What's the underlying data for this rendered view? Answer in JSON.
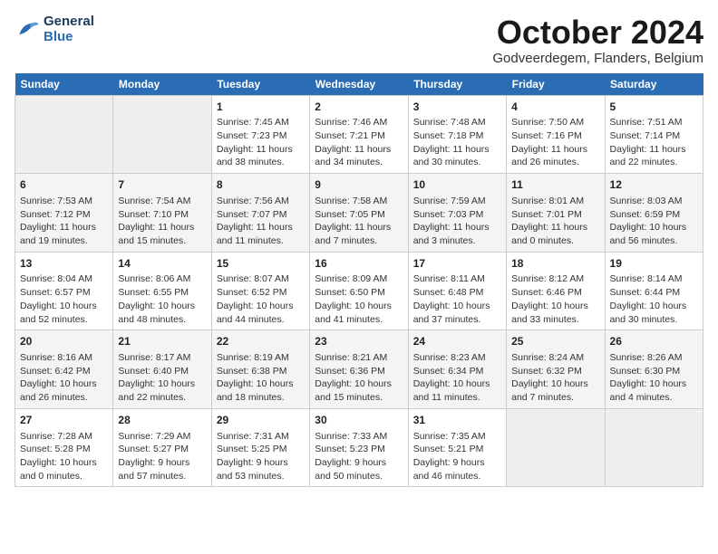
{
  "header": {
    "logo_line1": "General",
    "logo_line2": "Blue",
    "month": "October 2024",
    "location": "Godveerdegem, Flanders, Belgium"
  },
  "weekdays": [
    "Sunday",
    "Monday",
    "Tuesday",
    "Wednesday",
    "Thursday",
    "Friday",
    "Saturday"
  ],
  "weeks": [
    [
      {
        "day": "",
        "empty": true
      },
      {
        "day": "",
        "empty": true
      },
      {
        "day": "1",
        "sunrise": "Sunrise: 7:45 AM",
        "sunset": "Sunset: 7:23 PM",
        "daylight": "Daylight: 11 hours and 38 minutes."
      },
      {
        "day": "2",
        "sunrise": "Sunrise: 7:46 AM",
        "sunset": "Sunset: 7:21 PM",
        "daylight": "Daylight: 11 hours and 34 minutes."
      },
      {
        "day": "3",
        "sunrise": "Sunrise: 7:48 AM",
        "sunset": "Sunset: 7:18 PM",
        "daylight": "Daylight: 11 hours and 30 minutes."
      },
      {
        "day": "4",
        "sunrise": "Sunrise: 7:50 AM",
        "sunset": "Sunset: 7:16 PM",
        "daylight": "Daylight: 11 hours and 26 minutes."
      },
      {
        "day": "5",
        "sunrise": "Sunrise: 7:51 AM",
        "sunset": "Sunset: 7:14 PM",
        "daylight": "Daylight: 11 hours and 22 minutes."
      }
    ],
    [
      {
        "day": "6",
        "sunrise": "Sunrise: 7:53 AM",
        "sunset": "Sunset: 7:12 PM",
        "daylight": "Daylight: 11 hours and 19 minutes."
      },
      {
        "day": "7",
        "sunrise": "Sunrise: 7:54 AM",
        "sunset": "Sunset: 7:10 PM",
        "daylight": "Daylight: 11 hours and 15 minutes."
      },
      {
        "day": "8",
        "sunrise": "Sunrise: 7:56 AM",
        "sunset": "Sunset: 7:07 PM",
        "daylight": "Daylight: 11 hours and 11 minutes."
      },
      {
        "day": "9",
        "sunrise": "Sunrise: 7:58 AM",
        "sunset": "Sunset: 7:05 PM",
        "daylight": "Daylight: 11 hours and 7 minutes."
      },
      {
        "day": "10",
        "sunrise": "Sunrise: 7:59 AM",
        "sunset": "Sunset: 7:03 PM",
        "daylight": "Daylight: 11 hours and 3 minutes."
      },
      {
        "day": "11",
        "sunrise": "Sunrise: 8:01 AM",
        "sunset": "Sunset: 7:01 PM",
        "daylight": "Daylight: 11 hours and 0 minutes."
      },
      {
        "day": "12",
        "sunrise": "Sunrise: 8:03 AM",
        "sunset": "Sunset: 6:59 PM",
        "daylight": "Daylight: 10 hours and 56 minutes."
      }
    ],
    [
      {
        "day": "13",
        "sunrise": "Sunrise: 8:04 AM",
        "sunset": "Sunset: 6:57 PM",
        "daylight": "Daylight: 10 hours and 52 minutes."
      },
      {
        "day": "14",
        "sunrise": "Sunrise: 8:06 AM",
        "sunset": "Sunset: 6:55 PM",
        "daylight": "Daylight: 10 hours and 48 minutes."
      },
      {
        "day": "15",
        "sunrise": "Sunrise: 8:07 AM",
        "sunset": "Sunset: 6:52 PM",
        "daylight": "Daylight: 10 hours and 44 minutes."
      },
      {
        "day": "16",
        "sunrise": "Sunrise: 8:09 AM",
        "sunset": "Sunset: 6:50 PM",
        "daylight": "Daylight: 10 hours and 41 minutes."
      },
      {
        "day": "17",
        "sunrise": "Sunrise: 8:11 AM",
        "sunset": "Sunset: 6:48 PM",
        "daylight": "Daylight: 10 hours and 37 minutes."
      },
      {
        "day": "18",
        "sunrise": "Sunrise: 8:12 AM",
        "sunset": "Sunset: 6:46 PM",
        "daylight": "Daylight: 10 hours and 33 minutes."
      },
      {
        "day": "19",
        "sunrise": "Sunrise: 8:14 AM",
        "sunset": "Sunset: 6:44 PM",
        "daylight": "Daylight: 10 hours and 30 minutes."
      }
    ],
    [
      {
        "day": "20",
        "sunrise": "Sunrise: 8:16 AM",
        "sunset": "Sunset: 6:42 PM",
        "daylight": "Daylight: 10 hours and 26 minutes."
      },
      {
        "day": "21",
        "sunrise": "Sunrise: 8:17 AM",
        "sunset": "Sunset: 6:40 PM",
        "daylight": "Daylight: 10 hours and 22 minutes."
      },
      {
        "day": "22",
        "sunrise": "Sunrise: 8:19 AM",
        "sunset": "Sunset: 6:38 PM",
        "daylight": "Daylight: 10 hours and 18 minutes."
      },
      {
        "day": "23",
        "sunrise": "Sunrise: 8:21 AM",
        "sunset": "Sunset: 6:36 PM",
        "daylight": "Daylight: 10 hours and 15 minutes."
      },
      {
        "day": "24",
        "sunrise": "Sunrise: 8:23 AM",
        "sunset": "Sunset: 6:34 PM",
        "daylight": "Daylight: 10 hours and 11 minutes."
      },
      {
        "day": "25",
        "sunrise": "Sunrise: 8:24 AM",
        "sunset": "Sunset: 6:32 PM",
        "daylight": "Daylight: 10 hours and 7 minutes."
      },
      {
        "day": "26",
        "sunrise": "Sunrise: 8:26 AM",
        "sunset": "Sunset: 6:30 PM",
        "daylight": "Daylight: 10 hours and 4 minutes."
      }
    ],
    [
      {
        "day": "27",
        "sunrise": "Sunrise: 7:28 AM",
        "sunset": "Sunset: 5:28 PM",
        "daylight": "Daylight: 10 hours and 0 minutes."
      },
      {
        "day": "28",
        "sunrise": "Sunrise: 7:29 AM",
        "sunset": "Sunset: 5:27 PM",
        "daylight": "Daylight: 9 hours and 57 minutes."
      },
      {
        "day": "29",
        "sunrise": "Sunrise: 7:31 AM",
        "sunset": "Sunset: 5:25 PM",
        "daylight": "Daylight: 9 hours and 53 minutes."
      },
      {
        "day": "30",
        "sunrise": "Sunrise: 7:33 AM",
        "sunset": "Sunset: 5:23 PM",
        "daylight": "Daylight: 9 hours and 50 minutes."
      },
      {
        "day": "31",
        "sunrise": "Sunrise: 7:35 AM",
        "sunset": "Sunset: 5:21 PM",
        "daylight": "Daylight: 9 hours and 46 minutes."
      },
      {
        "day": "",
        "empty": true
      },
      {
        "day": "",
        "empty": true
      }
    ]
  ]
}
